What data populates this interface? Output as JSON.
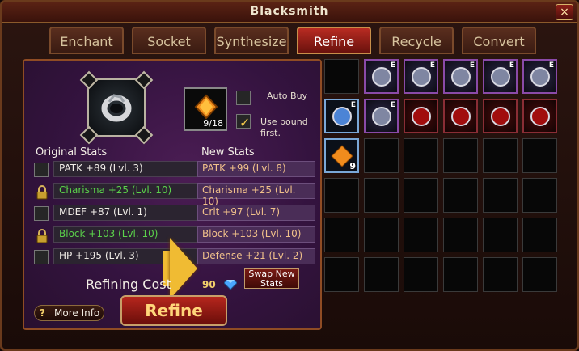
{
  "window": {
    "title": "Blacksmith",
    "close_label": "×"
  },
  "tabs": [
    {
      "label": "Enchant"
    },
    {
      "label": "Socket"
    },
    {
      "label": "Synthesize"
    },
    {
      "label": "Refine"
    },
    {
      "label": "Recycle"
    },
    {
      "label": "Convert"
    }
  ],
  "left": {
    "selected_item_icon": "ring-icon",
    "gem": {
      "icon": "amber-gem-icon",
      "count": "9/18"
    },
    "auto_buy_label": "Auto Buy",
    "auto_buy_checked": false,
    "use_bound_label": "Use bound\nfirst.",
    "use_bound_checked": true,
    "original_stats_title": "Original Stats",
    "new_stats_title": "New Stats",
    "original_stats": [
      {
        "text": "PATK +89 (Lvl. 3)",
        "locked": false
      },
      {
        "text": "Charisma +25 (Lvl. 10)",
        "locked": true
      },
      {
        "text": "MDEF +87 (Lvl. 1)",
        "locked": false
      },
      {
        "text": "Block +103 (Lvl. 10)",
        "locked": true
      },
      {
        "text": "HP +195 (Lvl. 3)",
        "locked": false
      }
    ],
    "new_stats": [
      {
        "text": "PATK +99 (Lvl. 8)"
      },
      {
        "text": "Charisma +25 (Lvl. 10)"
      },
      {
        "text": "Crit +97 (Lvl. 7)"
      },
      {
        "text": "Block +103 (Lvl. 10)"
      },
      {
        "text": "Defense +21 (Lvl. 2)"
      }
    ],
    "swap_label": "Swap New\nStats",
    "refining_cost_label": "Refining Cost",
    "refining_cost_value": "90",
    "more_info_label": "More Info",
    "refine_label": "Refine"
  },
  "inventory": [
    {
      "type": "empty"
    },
    {
      "type": "purple",
      "icon": "armor-icon",
      "badge": "E"
    },
    {
      "type": "purple",
      "icon": "ring-icon",
      "badge": "E"
    },
    {
      "type": "purple",
      "icon": "wings-icon",
      "badge": "E"
    },
    {
      "type": "purple",
      "icon": "mask-icon",
      "badge": "E"
    },
    {
      "type": "purple",
      "icon": "helmet-icon",
      "badge": "E"
    },
    {
      "type": "blue",
      "icon": "weapon-icon",
      "badge": "E"
    },
    {
      "type": "purple",
      "icon": "amulet-icon",
      "badge": "E"
    },
    {
      "type": "red",
      "icon": "red-item-icon"
    },
    {
      "type": "red",
      "icon": "red-item-icon"
    },
    {
      "type": "red",
      "icon": "red-item-icon"
    },
    {
      "type": "red",
      "icon": "red-item-icon"
    },
    {
      "type": "blue",
      "icon": "amber-gem-icon",
      "count": "9"
    }
  ]
}
